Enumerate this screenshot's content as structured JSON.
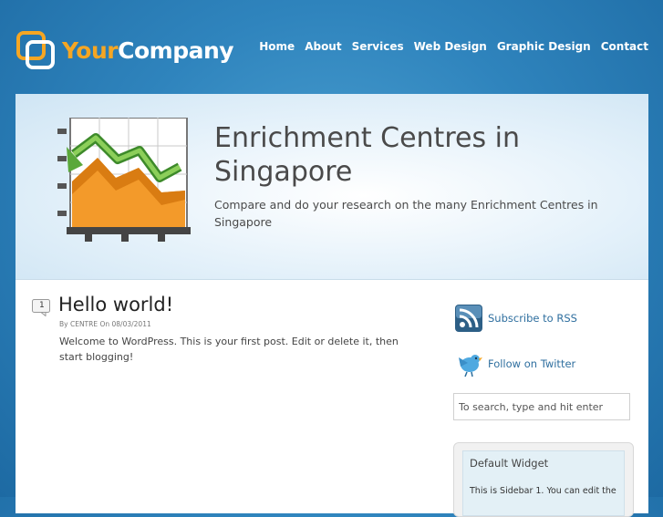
{
  "header": {
    "logo_your": "Your",
    "logo_company": "Company",
    "nav": [
      "Home",
      "About",
      "Services",
      "Web Design",
      "Graphic Design",
      "Contact"
    ]
  },
  "hero": {
    "title": "Enrichment Centres in Singapore",
    "subtitle": "Compare and do your research on the many Enrichment Centres in Singapore"
  },
  "post": {
    "number": "1",
    "title": "Hello world!",
    "meta": "By CENTRE On 08/03/2011",
    "body": "Welcome to WordPress. This is your first post. Edit or delete it, then start blogging!"
  },
  "sidebar": {
    "rss_label": "Subscribe to RSS",
    "twitter_label": "Follow on Twitter",
    "search_placeholder": "To search, type and hit enter",
    "widget_title": "Default Widget",
    "widget_text": "This is Sidebar 1. You can edit the"
  },
  "colors": {
    "accent": "#f5a623",
    "background": "#2f84bd",
    "link": "#2f6f9f"
  },
  "icons": [
    "logo-mark",
    "chart-icon",
    "rss-icon",
    "twitter-bird-icon"
  ]
}
